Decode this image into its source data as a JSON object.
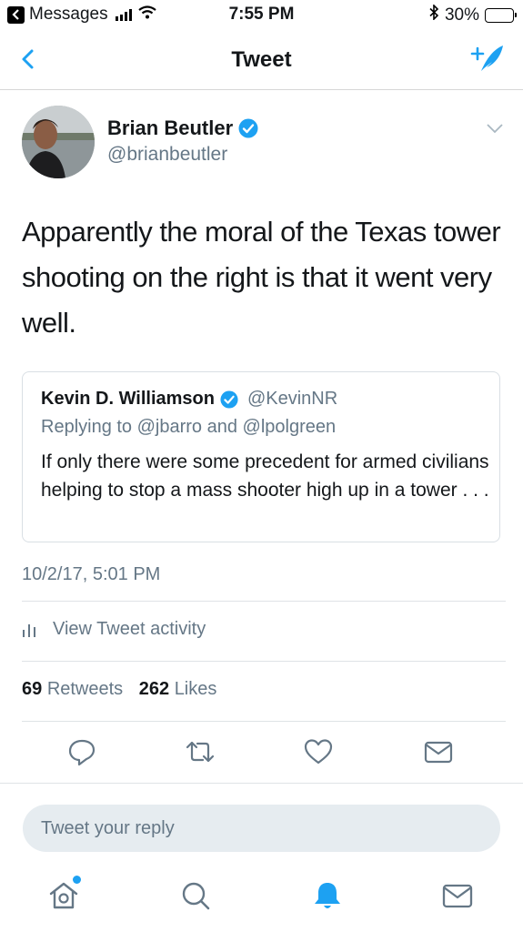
{
  "status_bar": {
    "back_app": "Messages",
    "time": "7:55 PM",
    "battery": "30%",
    "battery_level": 0.3
  },
  "nav": {
    "title": "Tweet"
  },
  "tweet": {
    "author_name": "Brian Beutler",
    "author_handle": "@brianbeutler",
    "text": "Apparently the moral of the Texas tower shooting on the right is that it went very well.",
    "timestamp": "10/2/17, 5:01 PM"
  },
  "quote": {
    "author_name": "Kevin D. Williamson",
    "author_handle": "@KevinNR",
    "replying_to": "Replying to @jbarro and @lpolgreen",
    "text": "If only there were some precedent for armed civilians helping to stop a mass shooter high up in a tower . . ."
  },
  "activity": {
    "label": "View Tweet activity"
  },
  "stats": {
    "retweets_count": "69",
    "retweets_label": "Retweets",
    "likes_count": "262",
    "likes_label": "Likes"
  },
  "reply": {
    "placeholder": "Tweet your reply"
  },
  "colors": {
    "accent": "#1da1f2",
    "secondary_text": "#657786",
    "primary_text": "#14171a"
  },
  "icons": {
    "actions": [
      "reply-icon",
      "retweet-icon",
      "like-icon",
      "dm-icon"
    ],
    "tabs": [
      "home-icon",
      "search-icon",
      "notifications-icon",
      "messages-icon"
    ]
  }
}
